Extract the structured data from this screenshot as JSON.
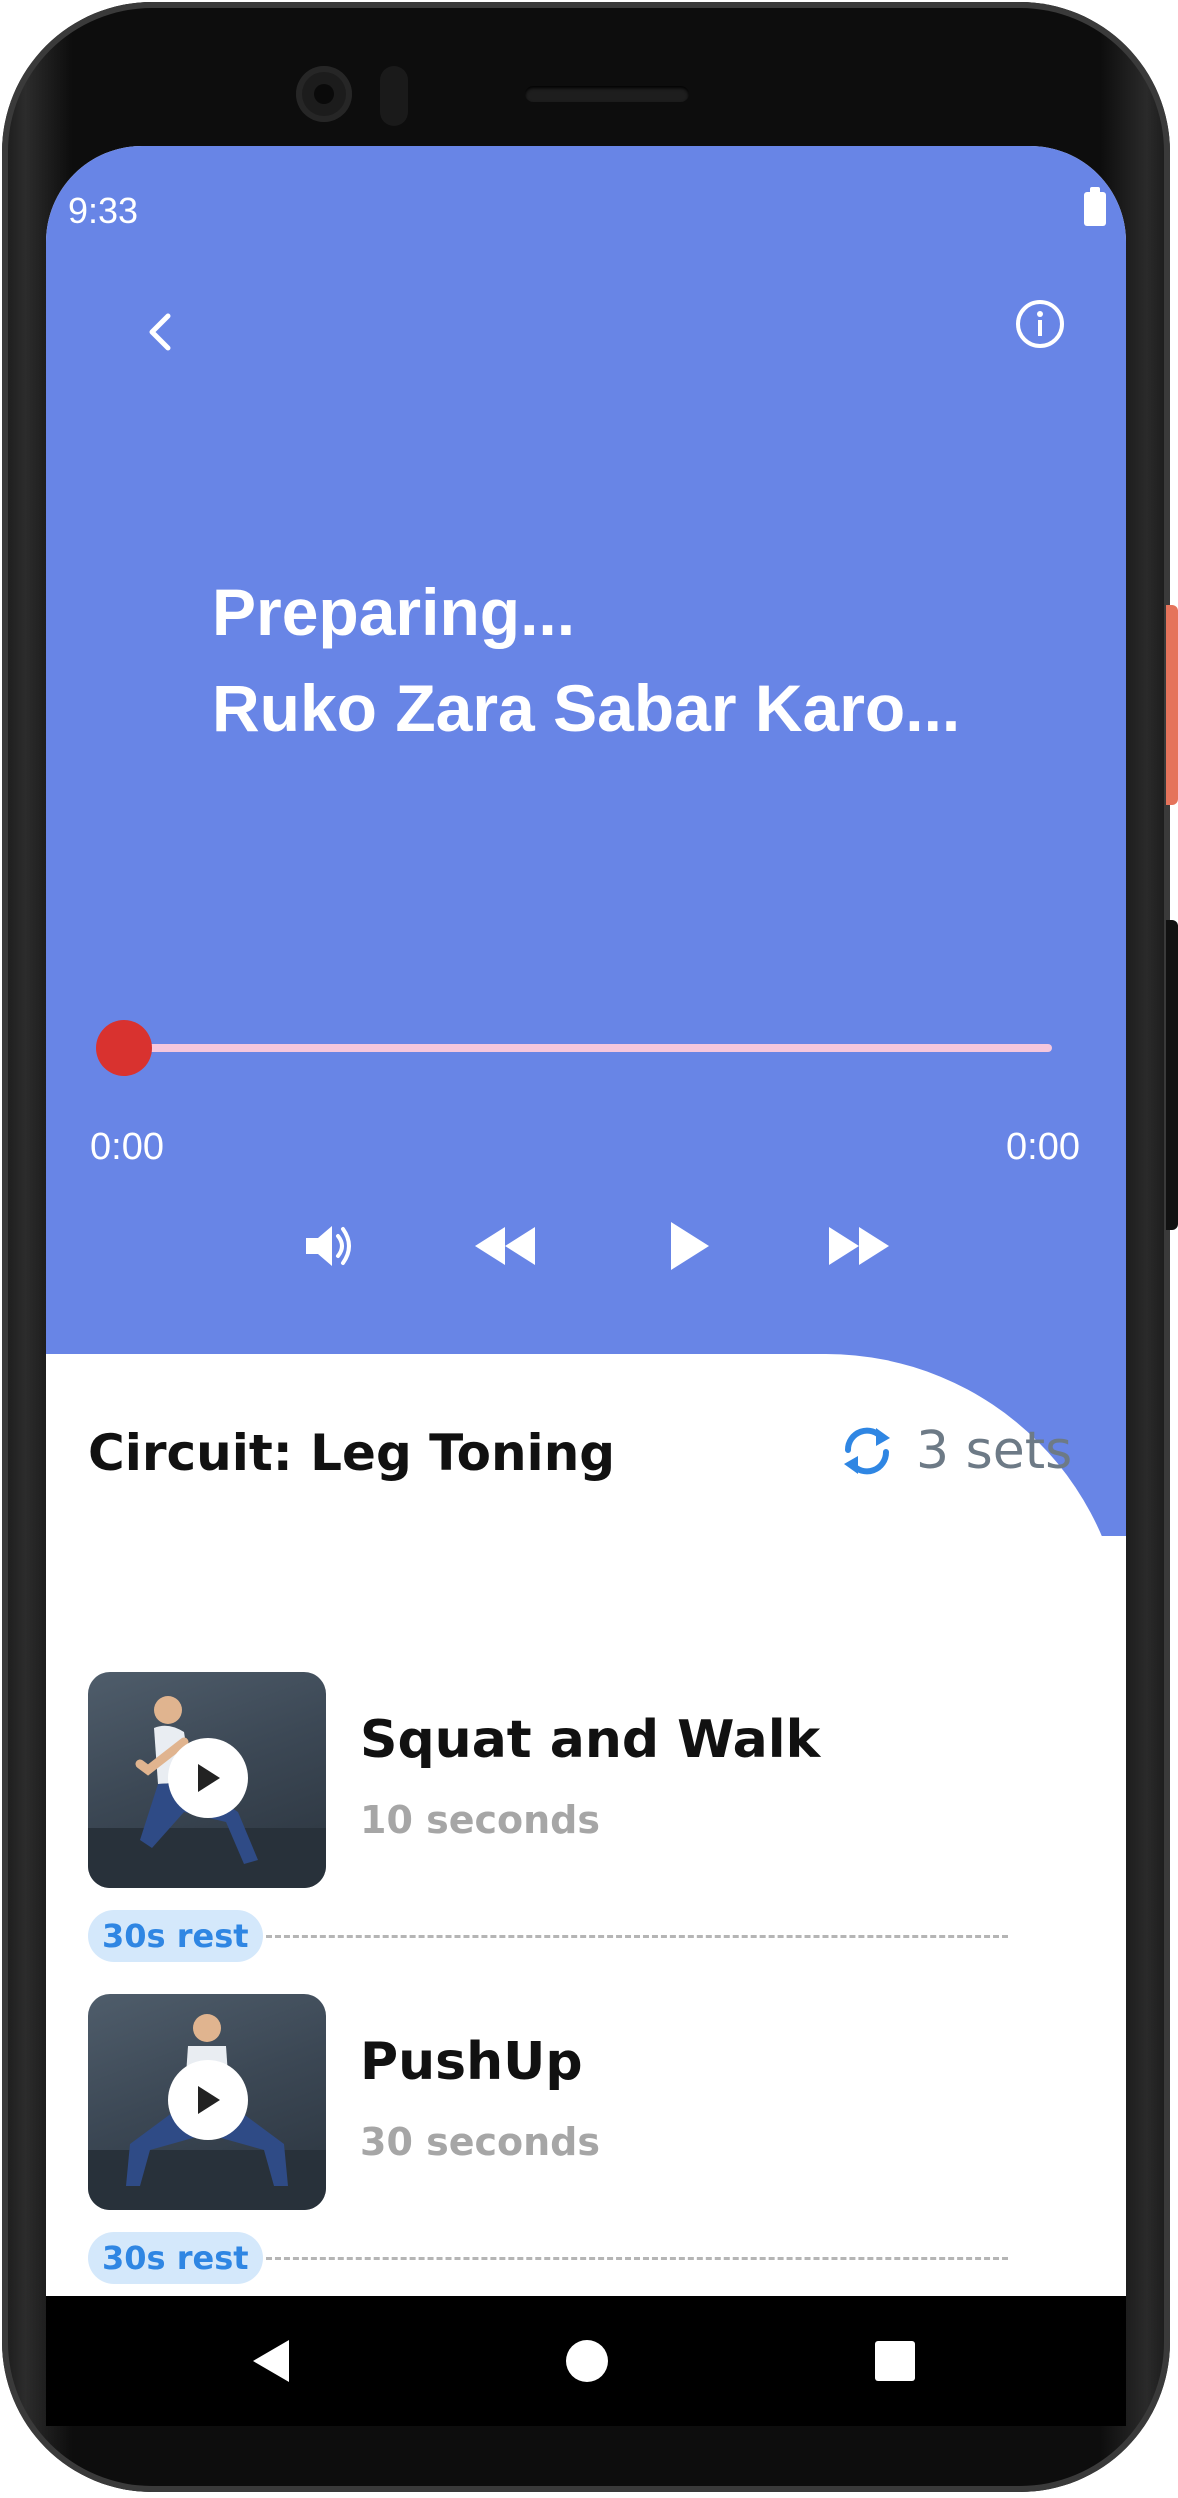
{
  "status_bar": {
    "time": "9:33"
  },
  "header": {
    "back_icon": "chevron-left-icon",
    "info_icon": "info-circle-icon"
  },
  "player": {
    "line1": "Preparing...",
    "line2": "Ruko Zara Sabar Karo...",
    "progress": 0,
    "time_elapsed": "0:00",
    "time_total": "0:00",
    "controls": [
      "volume-icon",
      "rewind-icon",
      "play-icon",
      "fast-forward-icon"
    ],
    "colors": {
      "background": "#6885e6",
      "thumb": "#d9322f",
      "track": "#f5c7dd"
    }
  },
  "circuit": {
    "title": "Circuit: Leg Toning",
    "sets_icon": "refresh-icon",
    "sets_label": "3 sets"
  },
  "exercises": [
    {
      "name": "Squat and Walk",
      "duration": "10 seconds",
      "rest": "30s rest"
    },
    {
      "name": "PushUp",
      "duration": "30 seconds",
      "rest": "30s rest"
    }
  ],
  "nav_bar": {
    "items": [
      "back-triangle-icon",
      "home-circle-icon",
      "recents-square-icon"
    ]
  }
}
